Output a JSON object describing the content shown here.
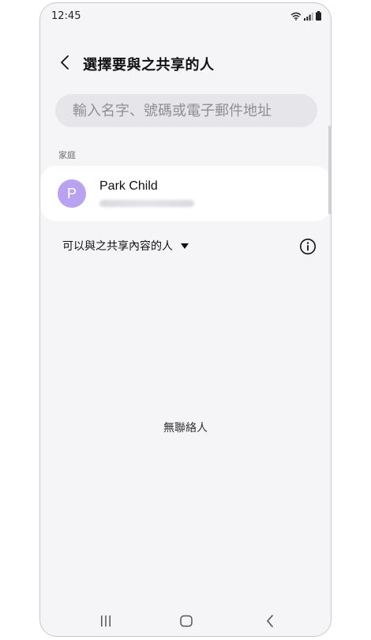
{
  "status_bar": {
    "time": "12:45"
  },
  "header": {
    "title": "選擇要與之共享的人"
  },
  "search": {
    "placeholder": "輸入名字、號碼或電子郵件地址"
  },
  "family_section": {
    "label": "家庭",
    "contacts": [
      {
        "initial": "P",
        "name": "Park Child"
      }
    ]
  },
  "filter": {
    "label": "可以與之共享內容的人"
  },
  "empty_state": {
    "message": "無聯絡人"
  },
  "colors": {
    "avatar": "#b9a2ef",
    "background": "#f5f5f7",
    "card": "#ffffff"
  },
  "icons": {
    "back": "chevron-left-icon",
    "info": "info-icon",
    "dropdown": "caret-down-icon",
    "nav_recents": "recents-icon",
    "nav_home": "home-icon",
    "nav_back": "back-icon"
  }
}
